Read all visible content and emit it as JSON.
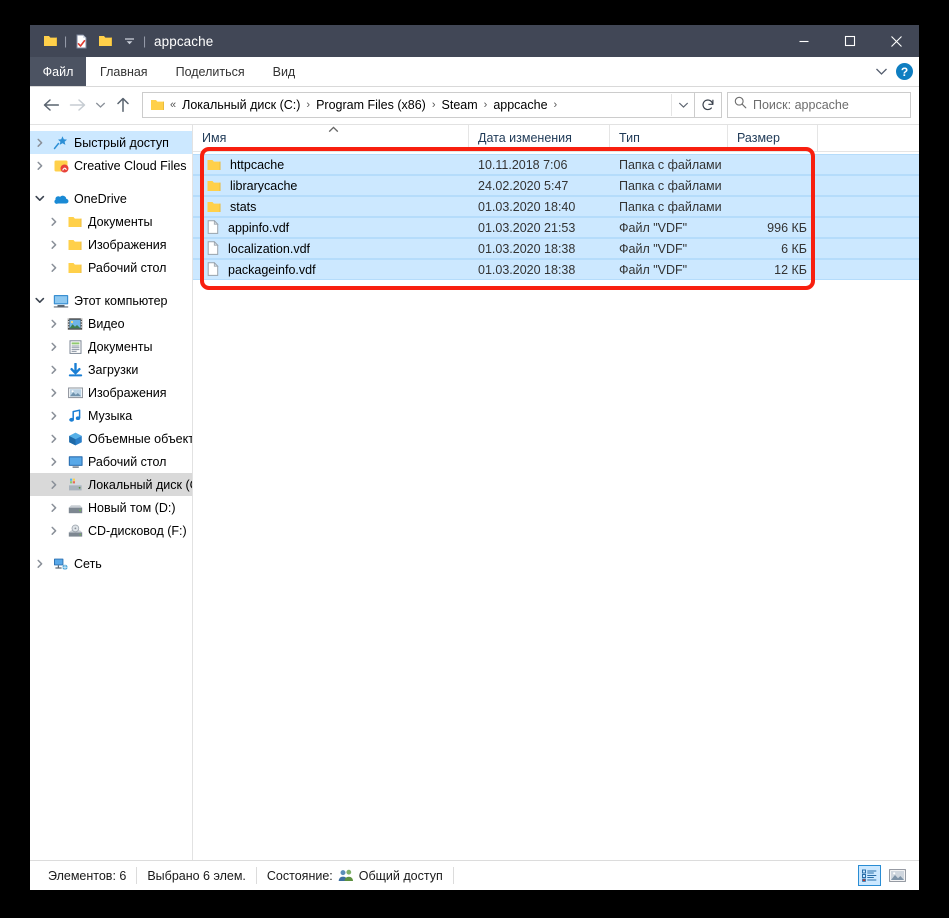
{
  "window": {
    "title": "appcache",
    "quick_access": [
      {
        "name": "folder-icon",
        "label": "folder"
      },
      {
        "name": "properties-icon",
        "label": "properties"
      },
      {
        "name": "new-folder-icon",
        "label": "new folder"
      },
      {
        "name": "customize-dropdown-icon",
        "label": "customize"
      }
    ],
    "controls": {
      "minimize": "minimize",
      "maximize": "maximize",
      "close": "close"
    }
  },
  "ribbon": {
    "file_tab": "Файл",
    "tabs": [
      "Главная",
      "Поделиться",
      "Вид"
    ],
    "collapse_icon": "chevron-down-icon",
    "help_label": "?"
  },
  "address": {
    "back_icon": "arrow-left-icon",
    "forward_icon": "arrow-right-icon",
    "recent_icon": "chevron-down-icon",
    "up_icon": "arrow-up-icon",
    "overflow": "«",
    "crumbs": [
      "Локальный диск (C:)",
      "Program Files (x86)",
      "Steam",
      "appcache"
    ],
    "dropdown_icon": "chevron-down-icon",
    "refresh_icon": "refresh-icon"
  },
  "search": {
    "icon": "search-icon",
    "placeholder": "Поиск: appcache"
  },
  "sidebar": {
    "groups": [
      {
        "items": [
          {
            "label": "Быстрый доступ",
            "icon": "pin-star-icon",
            "level": 1,
            "expander": "collapsed",
            "state": "selected-blue"
          },
          {
            "label": "Creative Cloud Files",
            "icon": "creative-cloud-icon",
            "level": 1,
            "expander": "collapsed",
            "state": "normal"
          }
        ]
      },
      {
        "items": [
          {
            "label": "OneDrive",
            "icon": "onedrive-cloud-icon",
            "level": 1,
            "expander": "expanded",
            "state": "normal"
          },
          {
            "label": "Документы",
            "icon": "folder-icon",
            "level": 2,
            "expander": "collapsed",
            "state": "normal"
          },
          {
            "label": "Изображения",
            "icon": "folder-icon",
            "level": 2,
            "expander": "collapsed",
            "state": "normal"
          },
          {
            "label": "Рабочий стол",
            "icon": "folder-icon",
            "level": 2,
            "expander": "collapsed",
            "state": "normal"
          }
        ]
      },
      {
        "items": [
          {
            "label": "Этот компьютер",
            "icon": "this-pc-icon",
            "level": 1,
            "expander": "expanded",
            "state": "normal"
          },
          {
            "label": "Видео",
            "icon": "videos-icon",
            "level": 2,
            "expander": "collapsed",
            "state": "normal"
          },
          {
            "label": "Документы",
            "icon": "documents-icon",
            "level": 2,
            "expander": "collapsed",
            "state": "normal"
          },
          {
            "label": "Загрузки",
            "icon": "downloads-icon",
            "level": 2,
            "expander": "collapsed",
            "state": "normal"
          },
          {
            "label": "Изображения",
            "icon": "pictures-icon",
            "level": 2,
            "expander": "collapsed",
            "state": "normal"
          },
          {
            "label": "Музыка",
            "icon": "music-icon",
            "level": 2,
            "expander": "collapsed",
            "state": "normal"
          },
          {
            "label": "Объемные объекты",
            "icon": "3d-objects-icon",
            "level": 2,
            "expander": "collapsed",
            "state": "normal"
          },
          {
            "label": "Рабочий стол",
            "icon": "desktop-icon",
            "level": 2,
            "expander": "collapsed",
            "state": "normal"
          },
          {
            "label": "Локальный диск (C:)",
            "icon": "system-drive-icon",
            "level": 2,
            "expander": "collapsed",
            "state": "selected-grey"
          },
          {
            "label": "Новый том (D:)",
            "icon": "drive-icon",
            "level": 2,
            "expander": "collapsed",
            "state": "normal"
          },
          {
            "label": "CD-дисковод (F:)",
            "icon": "cd-drive-icon",
            "level": 2,
            "expander": "collapsed",
            "state": "normal"
          }
        ]
      },
      {
        "items": [
          {
            "label": "Сеть",
            "icon": "network-icon",
            "level": 1,
            "expander": "collapsed",
            "state": "normal"
          }
        ]
      }
    ]
  },
  "filelist": {
    "columns": [
      "Имя",
      "Дата изменения",
      "Тип",
      "Размер"
    ],
    "sort_indicator": "sort-ascending-icon",
    "rows": [
      {
        "name": "httpcache",
        "date": "10.11.2018 7:06",
        "type": "Папка с файлами",
        "size": "",
        "icon": "folder-icon",
        "selected": true
      },
      {
        "name": "librarycache",
        "date": "24.02.2020 5:47",
        "type": "Папка с файлами",
        "size": "",
        "icon": "folder-icon",
        "selected": true
      },
      {
        "name": "stats",
        "date": "01.03.2020 18:40",
        "type": "Папка с файлами",
        "size": "",
        "icon": "folder-icon",
        "selected": true
      },
      {
        "name": "appinfo.vdf",
        "date": "01.03.2020 21:53",
        "type": "Файл \"VDF\"",
        "size": "996 КБ",
        "icon": "file-icon",
        "selected": true
      },
      {
        "name": "localization.vdf",
        "date": "01.03.2020 18:38",
        "type": "Файл \"VDF\"",
        "size": "6 КБ",
        "icon": "file-icon",
        "selected": true
      },
      {
        "name": "packageinfo.vdf",
        "date": "01.03.2020 18:38",
        "type": "Файл \"VDF\"",
        "size": "12 КБ",
        "icon": "file-icon",
        "selected": true
      }
    ]
  },
  "statusbar": {
    "item_count": "Элементов: 6",
    "selection": "Выбрано 6 элем.",
    "state_label": "Состояние:",
    "share_icon": "shared-users-icon",
    "share_label": "Общий доступ",
    "view_details_icon": "details-view-icon",
    "view_thumbs_icon": "thumbnail-view-icon"
  },
  "annotation": {
    "color": "#f81f0f",
    "shape": "rounded-rectangle"
  }
}
